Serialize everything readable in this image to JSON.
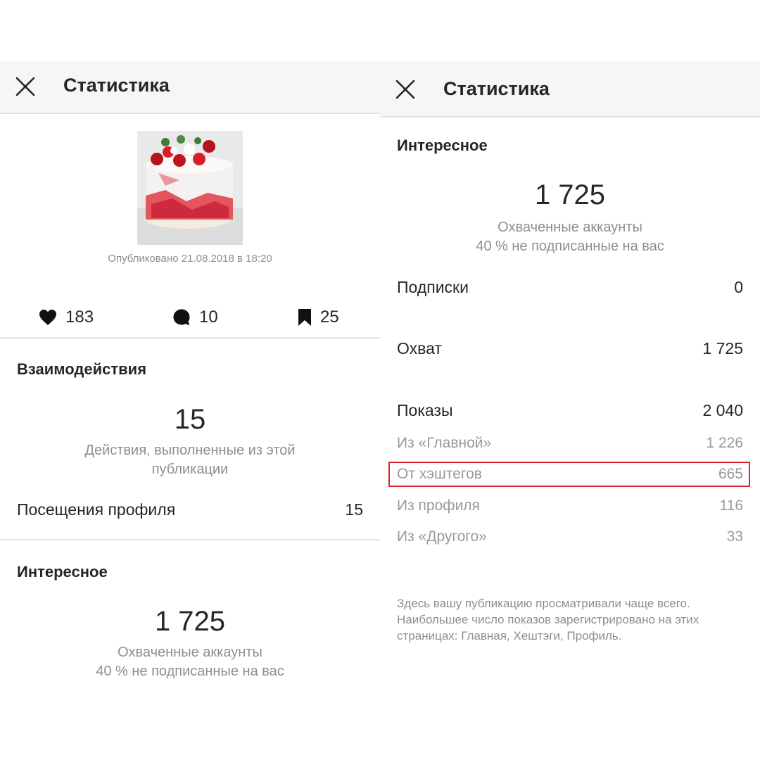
{
  "left": {
    "header_title": "Статистика",
    "published": "Опубликовано 21.08.2018 в 18:20",
    "stats": {
      "likes": "183",
      "comments": "10",
      "saves": "25"
    },
    "interactions": {
      "title": "Взаимодействия",
      "number": "15",
      "subtitle_line1": "Действия, выполненные из этой",
      "subtitle_line2": "публикации",
      "profile_visits_label": "Посещения профиля",
      "profile_visits_value": "15"
    },
    "discovery": {
      "title": "Интересное",
      "number": "1 725",
      "subtitle_line1": "Охваченные аккаунты",
      "subtitle_line2": "40 % не подписанные на вас"
    }
  },
  "right": {
    "header_title": "Статистика",
    "discovery": {
      "title": "Интересное",
      "number": "1 725",
      "subtitle_line1": "Охваченные аккаунты",
      "subtitle_line2": "40 % не подписанные на вас"
    },
    "follows": {
      "label": "Подписки",
      "value": "0"
    },
    "reach": {
      "label": "Охват",
      "value": "1 725"
    },
    "impressions": {
      "label": "Показы",
      "value": "2 040",
      "breakdown": [
        {
          "label": "Из «Главной»",
          "value": "1 226"
        },
        {
          "label": "От хэштегов",
          "value": "665"
        },
        {
          "label": "Из профиля",
          "value": "116"
        },
        {
          "label": "Из «Другого»",
          "value": "33"
        }
      ]
    },
    "note_line1": "Здесь вашу публикацию просматривали чаще всего.",
    "note_line2": "Наибольшее число показов зарегистрировано на этих",
    "note_line3": "страницах: Главная, Хештэги, Профиль."
  },
  "colors": {
    "highlight_border": "#e0242b",
    "secondary_text": "#8e8e8e",
    "header_bg": "#f6f6f6"
  },
  "icons": [
    "close-icon",
    "heart-icon",
    "comment-icon",
    "bookmark-icon"
  ]
}
